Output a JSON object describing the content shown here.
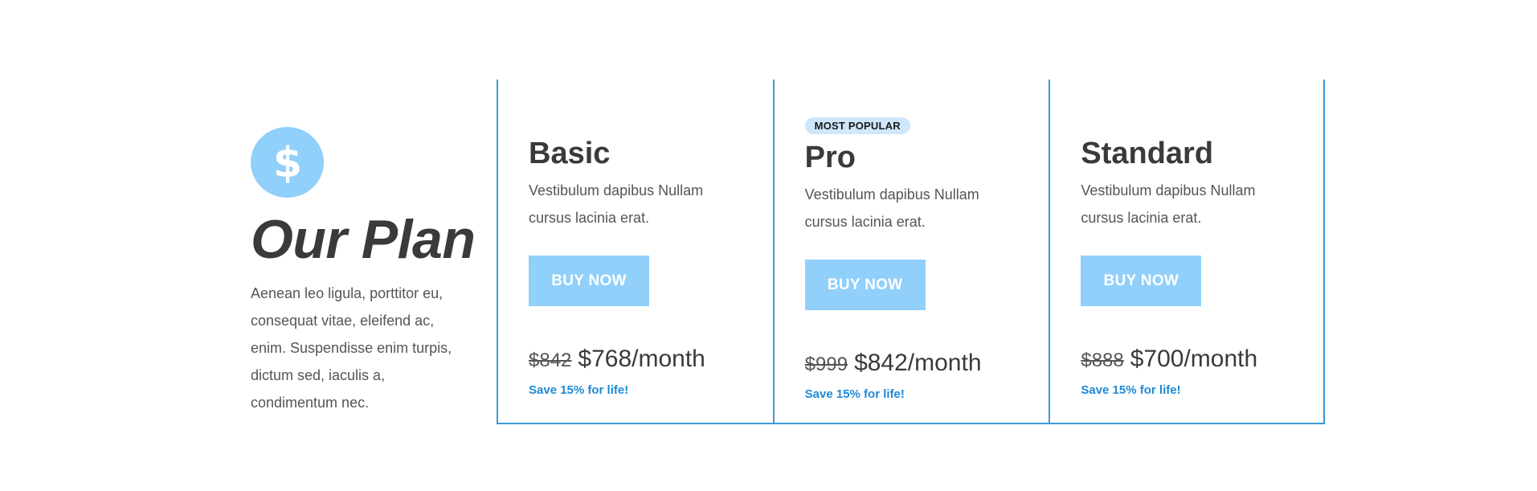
{
  "intro": {
    "icon": "dollar-icon",
    "icon_color": "#90d0fa",
    "icon_glyph": "$",
    "title": "Our Plan",
    "text": "Aenean leo ligula, porttitor eu, consequat vitae, eleifend ac, enim. Suspendisse enim turpis, dictum sed, iaculis a, condimentum nec."
  },
  "plans": [
    {
      "name": "Basic",
      "badge": "",
      "description": "Vestibulum dapibus Nullam cursus lacinia erat.",
      "button_label": "BUY NOW",
      "old_price": "$842",
      "price": "$768/month",
      "save_note": "Save 15% for life!"
    },
    {
      "name": "Pro",
      "badge": "MOST POPULAR",
      "description": "Vestibulum dapibus Nullam cursus lacinia erat.",
      "button_label": "BUY NOW",
      "old_price": "$999",
      "price": "$842/month",
      "save_note": "Save 15% for life!"
    },
    {
      "name": "Standard",
      "badge": "",
      "description": "Vestibulum dapibus Nullam cursus lacinia erat.",
      "button_label": "BUY NOW",
      "old_price": "$888",
      "price": "$700/month",
      "save_note": "Save 15% for life!"
    }
  ],
  "colors": {
    "accent": "#90d0fa",
    "border": "#3a9bd9",
    "save_note": "#1d8ad8",
    "badge_bg": "#cfe7fb"
  }
}
